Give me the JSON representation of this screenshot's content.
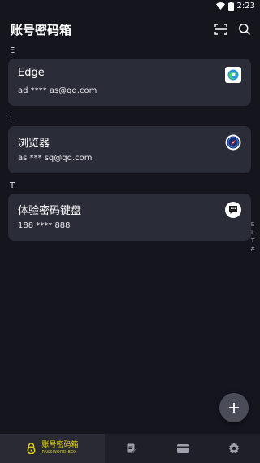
{
  "status_bar": {
    "time": "2:23"
  },
  "app_bar": {
    "title": "账号密码箱"
  },
  "sections": [
    {
      "header": "E",
      "title": "Edge",
      "subtitle": "ad **** as@qq.com",
      "logo": "edge-logo-icon"
    },
    {
      "header": "L",
      "title": "浏览器",
      "subtitle": "as *** sq@qq.com",
      "logo": "compass-logo-icon"
    },
    {
      "header": "T",
      "title": "体验密码键盘",
      "subtitle": "188 **** 888",
      "logo": "keyboard-chat-logo-icon"
    }
  ],
  "index_bar": [
    "E",
    "L",
    "T",
    "#"
  ],
  "bottom_nav": {
    "brand_name": "账号密码箱",
    "brand_sub": "PASSWORD BOX",
    "items": [
      "password-box-tab",
      "notes-tab",
      "cards-tab",
      "settings-tab"
    ]
  },
  "colors": {
    "background": "#14151d",
    "card": "#2a2c37",
    "accent": "#e6d300",
    "nav": "#1e1f27"
  }
}
